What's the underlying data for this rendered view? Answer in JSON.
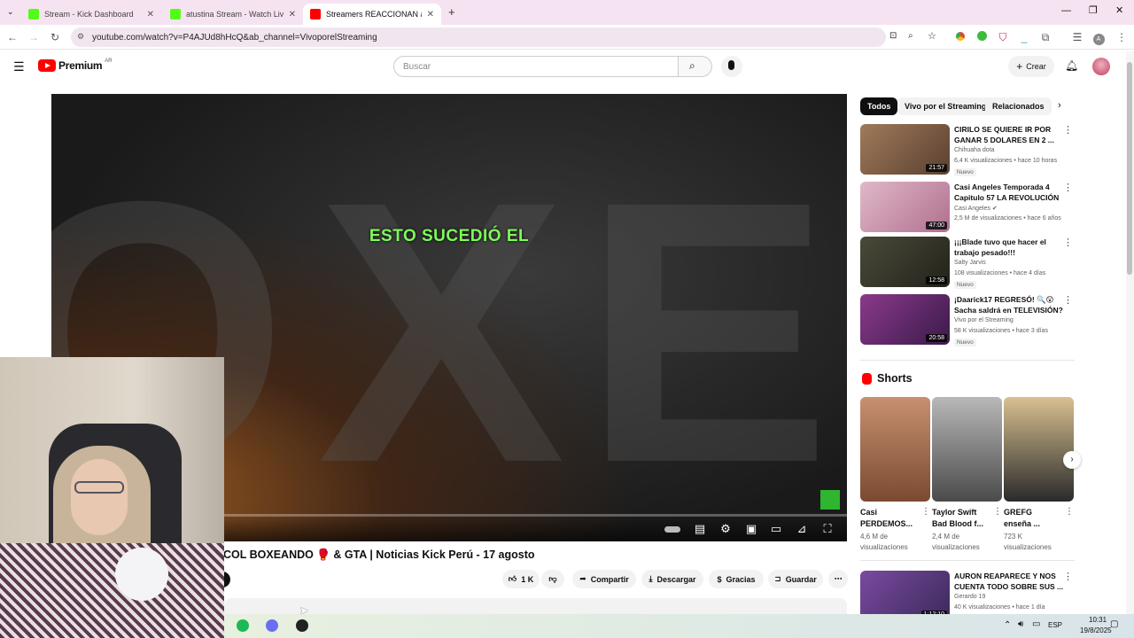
{
  "browser": {
    "tabs": [
      {
        "label": "Stream - Kick Dashboard",
        "fav_color": "#53fc18",
        "active": false
      },
      {
        "label": "atustina Stream - Watch Live on",
        "fav_color": "#53fc18",
        "active": false
      },
      {
        "label": "Streamers REACCIONAN a V",
        "fav_color": "#ff0000",
        "active": true
      }
    ],
    "url": "youtube.com/watch?v=P4AJUd8hHcQ&ab_channel=VivoporelStreaming"
  },
  "youtube": {
    "logo_text": "Premium",
    "region": "AR",
    "search_placeholder": "Buscar",
    "create_label": "Crear"
  },
  "video": {
    "overlay_text": "ESTO SUCEDIÓ EL",
    "title": "COL BOXEANDO 🥊 & GTA | Noticias Kick Perú - 17 agosto",
    "likes": "1 K",
    "share_label": "Compartir",
    "download_label": "Descargar",
    "thanks_label": "Gracias",
    "save_label": "Guardar"
  },
  "chips": [
    "Todos",
    "Vivo por el Streaming",
    "Relacionados"
  ],
  "recommendations": [
    {
      "title": "CIRILO SE QUIERE IR POR GANAR 5 DOLARES EN 2 ...",
      "channel": "Chihuaha dota",
      "meta": "6,4 K visualizaciones • hace 10 horas",
      "badge": "Nuevo",
      "duration": "21:57",
      "thumb_color": "#7a5a3a"
    },
    {
      "title": "Casi Angeles Temporada 4 Capitulo 57 LA REVOLUCIÓN ...",
      "channel": "Casi Angeles",
      "meta": "2,5 M de visualizaciones • hace 6 años",
      "badge": "",
      "duration": "47:00",
      "thumb_color": "#c89ab0"
    },
    {
      "title": "¡¡¡Blade tuvo que hacer el trabajo pesado!!!",
      "channel": "Salty Jarvis",
      "meta": "108 visualizaciones • hace 4 días",
      "badge": "Nuevo",
      "duration": "12:58",
      "thumb_color": "#3a3a2e"
    },
    {
      "title": "¡Daarick17 REGRESÓ! 🔍😲 Sacha saldrá en TELEVISIÓN? ...",
      "channel": "Vivo por el Streaming",
      "meta": "58 K visualizaciones • hace 3 días",
      "badge": "Nuevo",
      "duration": "20:58",
      "thumb_color": "#6a2a6a"
    }
  ],
  "shorts": {
    "heading": "Shorts",
    "items": [
      {
        "title": "Casi PERDEMOS...",
        "views": "4,6 M de visualizaciones",
        "thumb_color": "#b07a5a"
      },
      {
        "title": "Taylor Swift Bad Blood f...",
        "views": "2,4 M de visualizaciones",
        "thumb_color": "#8a8a8a"
      },
      {
        "title": "GREFG enseña ...",
        "views": "723 K visualizaciones",
        "thumb_color": "#c8a060"
      }
    ]
  },
  "bottom_rec": {
    "title": "AURON REAPARECE Y NOS CUENTA TODO SOBRE SUS ...",
    "channel": "Gerardo 19",
    "meta": "40 K visualizaciones • hace 1 día",
    "duration": "1:12:10",
    "thumb_color": "#5a3a7a"
  },
  "taskbar": {
    "language": "ESP",
    "time": "10:31",
    "date": "19/8/2025"
  }
}
